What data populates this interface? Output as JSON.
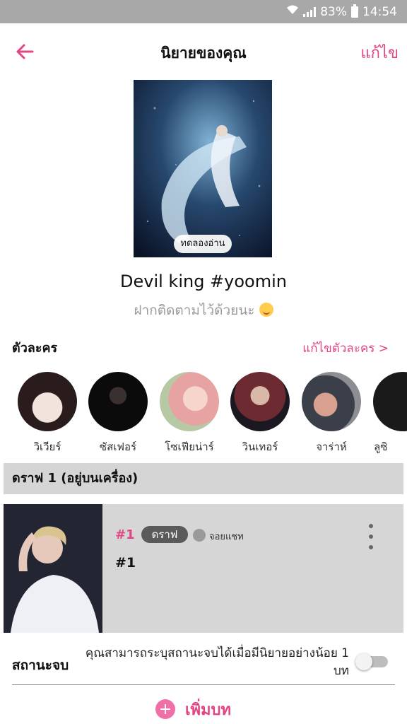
{
  "status_bar": {
    "battery": "83%",
    "time": "14:54"
  },
  "header": {
    "title": "นิยายของคุณ",
    "edit_label": "แก้ไข"
  },
  "story": {
    "trial_read_label": "ทดลองอ่าน",
    "title": "Devil king #yoomin",
    "subtitle": "ฝากติดตามไว้ด้วยนะ"
  },
  "characters": {
    "heading": "ตัวละคร",
    "edit_label": "แก้ไขตัวละคร >",
    "items": [
      {
        "name": "วิเวียร์"
      },
      {
        "name": "ซัสเฟอร์"
      },
      {
        "name": "โซเฟียน่าร์"
      },
      {
        "name": "วินเทอร์"
      },
      {
        "name": "จาร่าห์"
      },
      {
        "name": "ลูซิ"
      }
    ]
  },
  "draft": {
    "section_label": "ดราฟ 1 (อยู่บนเครื่อง)",
    "chapter": {
      "number": "#1",
      "badge": "ดราฟ",
      "type_label": "จอยแชท",
      "title": "#1"
    }
  },
  "end_status": {
    "label": "สถานะจบ",
    "description": "คุณสามารถระบุสถานะจบได้เมื่อมีนิยายอย่างน้อย 1 บท",
    "enabled": false
  },
  "add_chapter_label": "เพิ่มบท",
  "colors": {
    "accent": "#e24584",
    "status_bar": "#a8a8a8",
    "draft_bg": "#d6d6d6"
  }
}
